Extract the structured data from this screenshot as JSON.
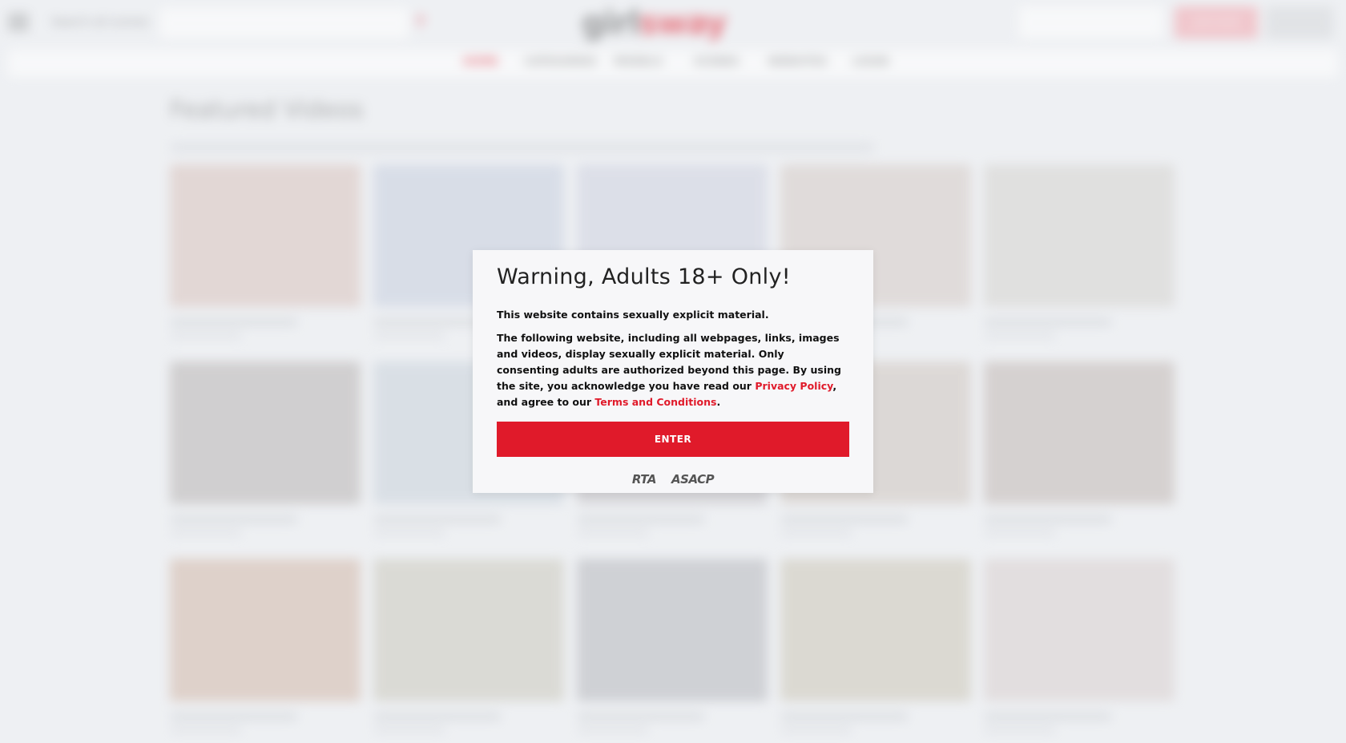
{
  "background": {
    "search_label": "Search all scenes",
    "logo": {
      "part1": "girl",
      "part2": "sway"
    },
    "join_label": "JOIN NOW",
    "nav": [
      "HOME",
      "CATEGORIES",
      "MODELS",
      "SCENES",
      "WEBSITES",
      "LOGIN"
    ],
    "section_title": "Featured Videos",
    "thumb_colors": [
      "#d9c3bd",
      "#c7cfdf",
      "#cfd2e0",
      "#d5cbc6",
      "#d5d3cf",
      "#b9b5b4",
      "#c9d2db",
      "#c3c0c4",
      "#cfc6bf",
      "#c2b8b4",
      "#d2b8a9",
      "#cbc9bd",
      "#b7b8bd",
      "#ccc7b8",
      "#d9d0cf"
    ]
  },
  "modal": {
    "title": "Warning, Adults 18+ Only!",
    "line1": "This website contains sexually explicit material.",
    "para_before": "The following website, including all webpages, links, images and videos, display sexually explicit material. Only consenting adults are authorized beyond this page. By using the site, you acknowledge you have read our ",
    "privacy_link": "Privacy Policy",
    "para_middle": ", and agree to our ",
    "terms_link": "Terms and Conditions",
    "para_end": ".",
    "enter_label": "ENTER",
    "badges": [
      "RTA",
      "ASACP"
    ],
    "accent_color": "#e01a2a"
  }
}
